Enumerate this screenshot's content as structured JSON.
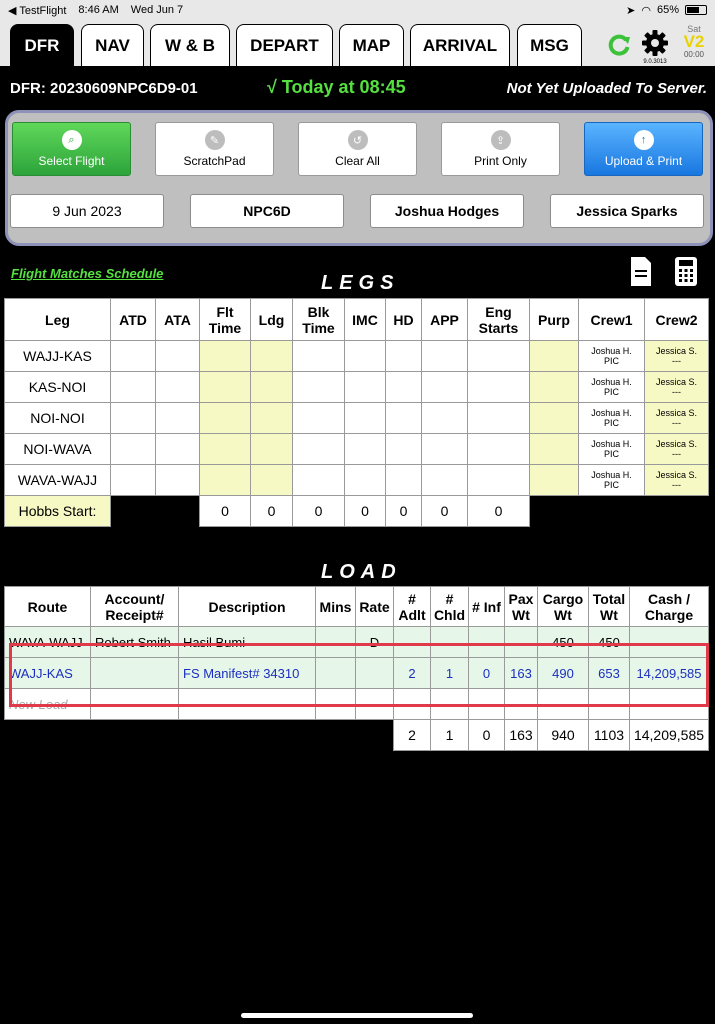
{
  "status_bar": {
    "app": "TestFlight",
    "time": "8:46 AM",
    "date": "Wed Jun 7",
    "battery": "65%",
    "battery_level": 0.65
  },
  "tabs": [
    {
      "label": "DFR",
      "active": true
    },
    {
      "label": "NAV"
    },
    {
      "label": "W & B"
    },
    {
      "label": "DEPART"
    },
    {
      "label": "MAP"
    },
    {
      "label": "ARRIVAL"
    },
    {
      "label": "MSG"
    }
  ],
  "toolbar_right": {
    "gear_version": "9.0.3013",
    "day": "Sat",
    "v_badge": "V2",
    "clock": "00:00"
  },
  "dfr": {
    "id": "DFR: 20230609NPC6D9-01",
    "today": "√ Today at 08:45",
    "upload_status": "Not Yet Uploaded To Server."
  },
  "actions": [
    {
      "label": "Select Flight",
      "icon": "search-icon"
    },
    {
      "label": "ScratchPad",
      "icon": "pencil-icon"
    },
    {
      "label": "Clear All",
      "icon": "undo-icon"
    },
    {
      "label": "Print Only",
      "icon": "share-icon"
    },
    {
      "label": "Upload & Print",
      "icon": "upload-icon"
    }
  ],
  "fields": {
    "date": "9 Jun 2023",
    "aircraft": "NPC6D",
    "crew1": "Joshua Hodges",
    "crew2": "Jessica Sparks"
  },
  "match_link": "Flight Matches Schedule",
  "legs": {
    "title": "LEGS",
    "headers": [
      "Leg",
      "ATD",
      "ATA",
      "Flt Time",
      "Ldg",
      "Blk Time",
      "IMC",
      "HD",
      "APP",
      "Eng Starts",
      "Purp",
      "Crew1",
      "Crew2"
    ],
    "rows": [
      {
        "leg": "WAJJ-KAS",
        "crew1": "Joshua H.",
        "crew1_role": "PIC",
        "crew2": "Jessica S.",
        "crew2_role": "---"
      },
      {
        "leg": "KAS-NOI",
        "crew1": "Joshua H.",
        "crew1_role": "PIC",
        "crew2": "Jessica S.",
        "crew2_role": "---"
      },
      {
        "leg": "NOI-NOI",
        "crew1": "Joshua H.",
        "crew1_role": "PIC",
        "crew2": "Jessica S.",
        "crew2_role": "---"
      },
      {
        "leg": "NOI-WAVA",
        "crew1": "Joshua H.",
        "crew1_role": "PIC",
        "crew2": "Jessica S.",
        "crew2_role": "---"
      },
      {
        "leg": "WAVA-WAJJ",
        "crew1": "Joshua H.",
        "crew1_role": "PIC",
        "crew2": "Jessica S.",
        "crew2_role": "---"
      }
    ],
    "hobbs_label": "Hobbs Start:",
    "totals": [
      "0",
      "0",
      "0",
      "0",
      "0",
      "0",
      "0"
    ]
  },
  "load": {
    "title": "LOAD",
    "headers": [
      "Route",
      "Account/ Receipt#",
      "Description",
      "Mins",
      "Rate",
      "# Adlt",
      "# Chld",
      "# Inf",
      "Pax Wt",
      "Cargo Wt",
      "Total Wt",
      "Cash / Charge"
    ],
    "rows": [
      {
        "route": "WAVA-WAJJ",
        "account": "Robert Smith",
        "description": "Hasil Bumi",
        "mins": "",
        "rate": "D",
        "adlt": "",
        "chld": "",
        "inf": "",
        "pax": "",
        "cargo": "450",
        "total": "450",
        "cash": ""
      },
      {
        "route": "WAJJ-KAS",
        "account": "",
        "description": "FS Manifest# 34310",
        "mins": "",
        "rate": "",
        "adlt": "2",
        "chld": "1",
        "inf": "0",
        "pax": "163",
        "cargo": "490",
        "total": "653",
        "cash": "14,209,585"
      },
      {
        "route": "New Load",
        "account": "",
        "description": "",
        "mins": "",
        "rate": "",
        "adlt": "",
        "chld": "",
        "inf": "",
        "pax": "",
        "cargo": "",
        "total": "",
        "cash": ""
      }
    ],
    "totals": {
      "adlt": "2",
      "chld": "1",
      "inf": "0",
      "pax": "163",
      "cargo": "940",
      "total": "1103",
      "cash": "14,209,585"
    }
  }
}
